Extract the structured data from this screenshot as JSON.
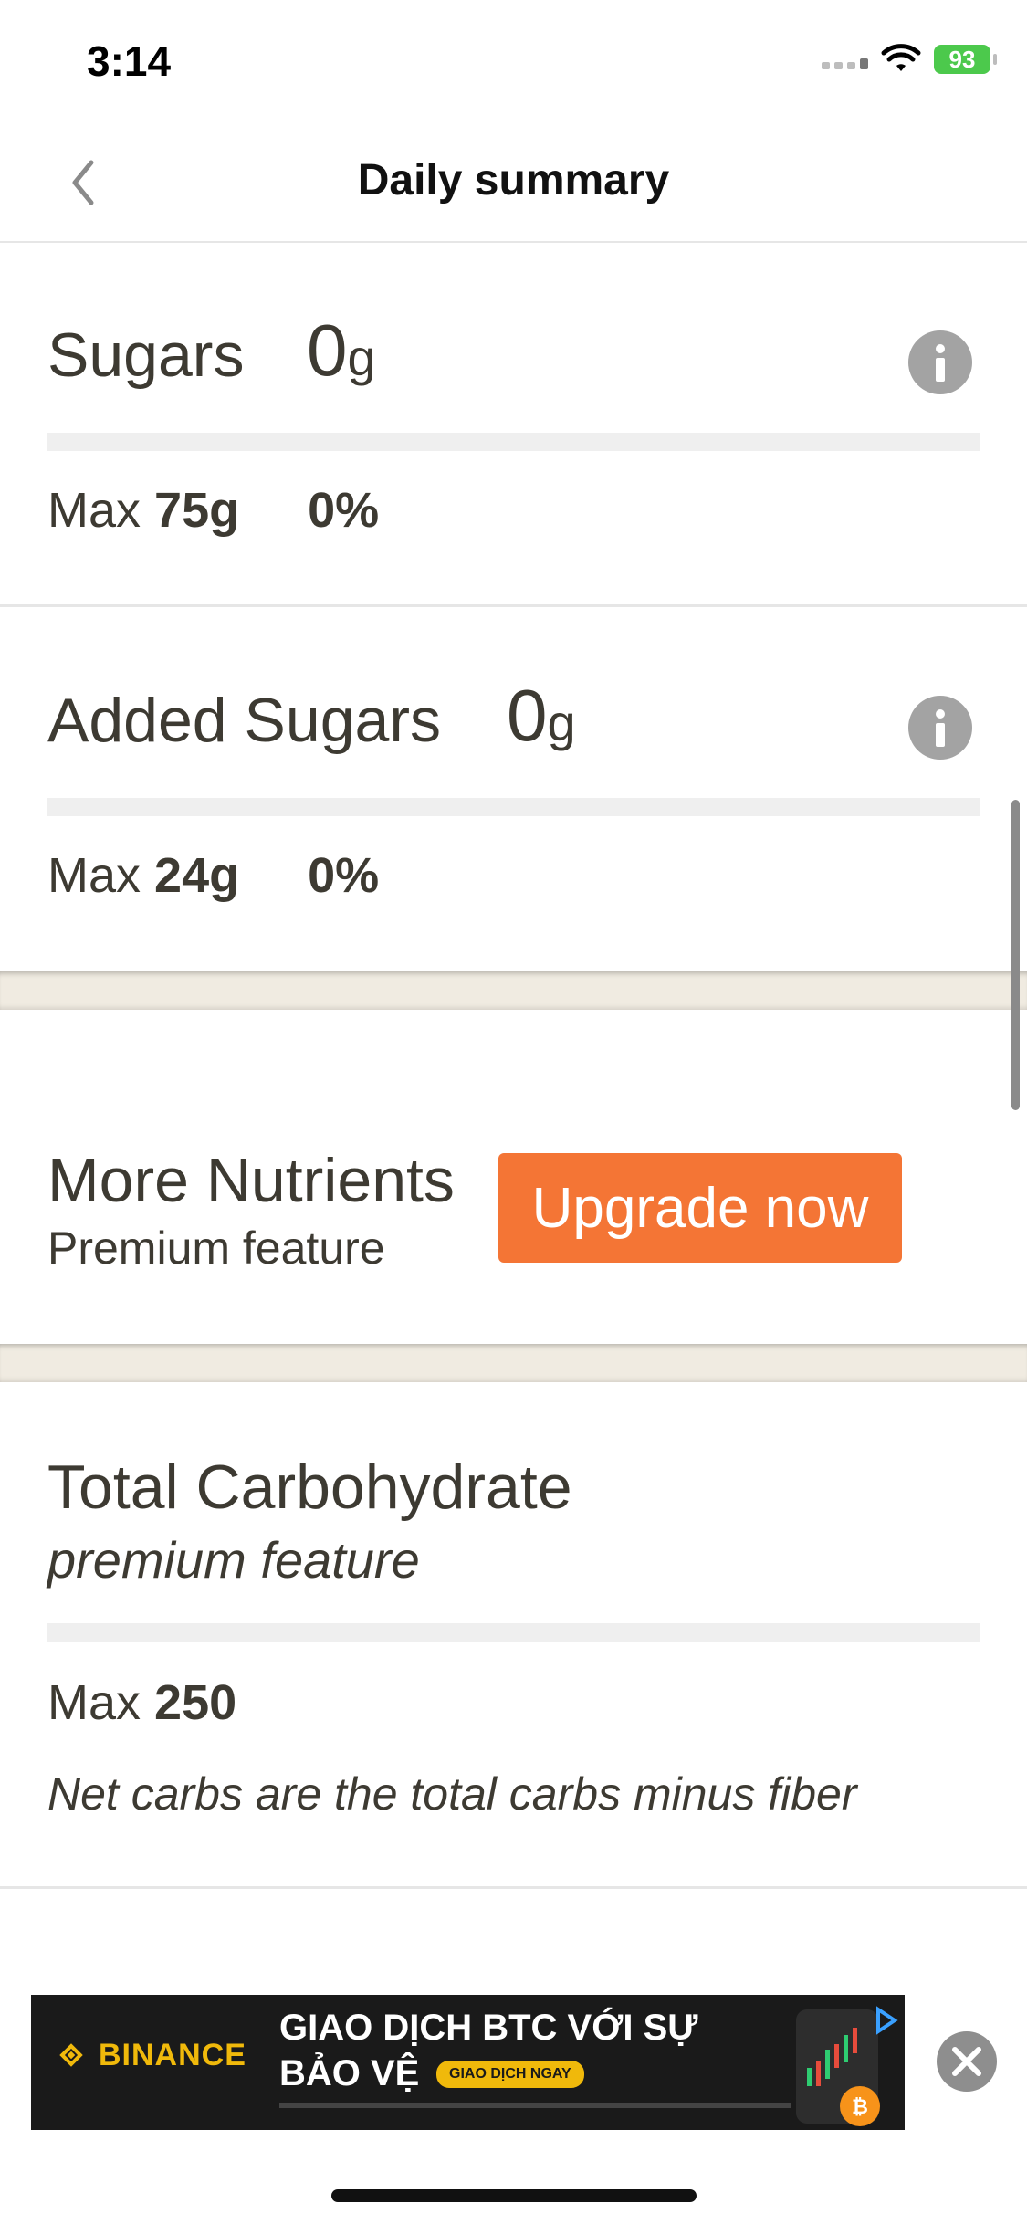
{
  "status_bar": {
    "time": "3:14",
    "battery": "93"
  },
  "header": {
    "title": "Daily summary"
  },
  "nutrients": [
    {
      "name": "Sugars",
      "value": "0",
      "unit": "g",
      "max_label": "Max",
      "max": "75g",
      "percent": "0%",
      "progress": 0
    },
    {
      "name": "Added Sugars",
      "value": "0",
      "unit": "g",
      "max_label": "Max",
      "max": "24g",
      "percent": "0%",
      "progress": 0
    }
  ],
  "more_nutrients": {
    "title": "More Nutrients",
    "subtitle": "Premium feature",
    "button": "Upgrade now"
  },
  "total_carbohydrate": {
    "title": "Total Carbohydrate",
    "subtitle": "premium feature",
    "max_label": "Max",
    "max": "250",
    "note": "Net carbs are the total carbs minus fiber"
  },
  "ad": {
    "brand": "BINANCE",
    "headline_line1": "GIAO DỊCH BTC VỚI SỰ",
    "headline_line2": "BẢO VỆ",
    "cta": "GIAO DỊCH NGAY"
  },
  "colors": {
    "accent": "#f47535",
    "band": "#f0ebe1",
    "text": "#3d3a32",
    "ad_brand": "#f0b90b"
  }
}
